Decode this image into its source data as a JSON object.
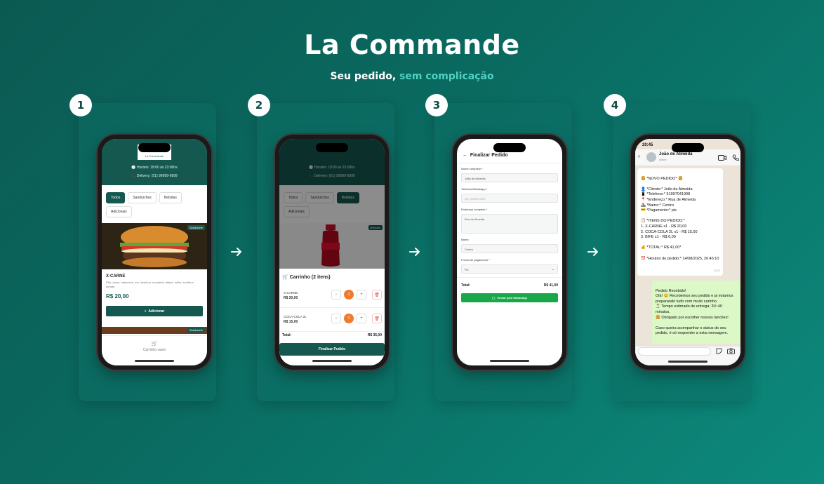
{
  "hero": {
    "title": "La Commande",
    "subtitle_plain": "Seu pedido,",
    "subtitle_accent": "sem complicação"
  },
  "steps": [
    "1",
    "2",
    "3",
    "4"
  ],
  "screen1": {
    "logo_text": "La Commande",
    "hours": "Horário: 18:00 às 23:00hs",
    "delivery": "Delivery: (51) 99999-9999",
    "tabs": [
      "Todos",
      "Sanduíches",
      "Bebidas",
      "Adicionais"
    ],
    "tag": "Sanduíche",
    "product_name": "X-CARNE",
    "product_desc": "Pão, carne, maionese, ovo, ketchup, mostarda, alface, milho, ervilha e tomate.",
    "product_price": "R$ 20,00",
    "add_button": "Adicionar",
    "tag2": "Sanduíche",
    "cart_empty": "Carrinho vazio"
  },
  "screen2": {
    "hours": "Horário: 18:00 às 23:00hs",
    "delivery": "Delivery: (51) 99999-9999",
    "tabs": [
      "Todos",
      "Sanduíches",
      "Bebidas",
      "Adicionais"
    ],
    "tag": "Bebidas",
    "cart_title": "Carrinho (2 itens)",
    "items": [
      {
        "name": "X-CARNE",
        "price": "R$ 20,00",
        "qty": "1"
      },
      {
        "name": "COCA-COLA 2L",
        "price": "R$ 15,00",
        "qty": "1"
      }
    ],
    "total_label": "Total:",
    "total_value": "R$ 35,00",
    "checkout_button": "Finalizar Pedido"
  },
  "screen3": {
    "title": "Finalizar Pedido",
    "fields": [
      {
        "label": "Nome completo *",
        "value": "João de Almeida"
      },
      {
        "label": "Telefone/WhatsApp *",
        "value": "(51) 99999-9999"
      },
      {
        "label": "Endereço completo *",
        "value": "Rua de Almeida"
      },
      {
        "label": "Bairro",
        "value": "Centro"
      },
      {
        "label": "Forma de pagamento *",
        "value": "Pix"
      }
    ],
    "total_label": "Total:",
    "total_value": "R$ 41,00",
    "send_button": "Enviar pelo WhatsApp"
  },
  "screen4": {
    "time": "20:45",
    "contact_name": "João de Almeida",
    "contact_status": "online",
    "incoming": "🍔 *NOVO PEDIDO* 🍔\n\n👤 *Cliente:* João de Almeida\n📱 *Telefone:* 51997041908\n📍 *Endereço:* Rua de Almeida\n🏘 *Bairro:* Centro\n💳 *Pagamento:* pix\n\n📋 *ITENS DO PEDIDO:*\n1. X-CARNE x1 - R$ 20,00\n2. COCA-COLA 2L x1 - R$ 15,00\n3. BIFE x1 - R$ 6,00\n\n💰 *TOTAL:* R$ 41,00*\n\n⏰ *Horário do pedido:* 14/08/2025, 20:45:10",
    "incoming_time": "20:47",
    "outgoing": "Pedido Recebido!\nOlá! 😊 Recebemos seu pedido e já estamos preparando tudo com muito carinho.\n⏳ Tempo estimado de entrega: 30~40 minutos.\n🍔 Obrigado por escolher nossos lanches!\n\nCaso queira acompanhar o status do seu pedido, é só responder a esta mensagem."
  }
}
